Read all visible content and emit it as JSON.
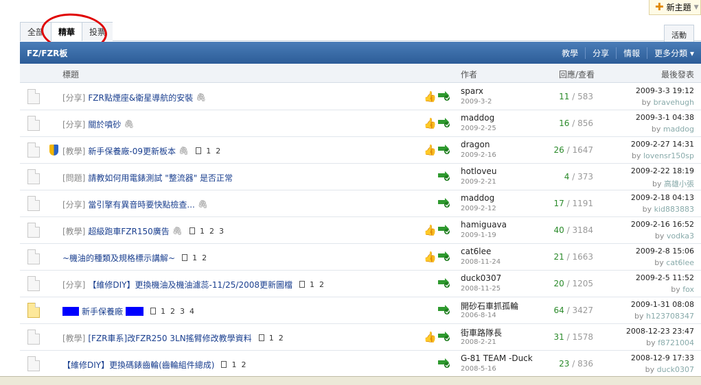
{
  "new_topic_label": "新主題",
  "tabs": [
    {
      "label": "全部",
      "active": false
    },
    {
      "label": "精華",
      "active": true
    },
    {
      "label": "投票",
      "active": false
    },
    {
      "label": "活動",
      "active": false
    }
  ],
  "forum": {
    "title": "FZ/FZR板",
    "categories": [
      "教學",
      "分享",
      "情報",
      "更多分類 ▾"
    ]
  },
  "columns": {
    "title": "標題",
    "author": "作者",
    "replies": "回應/查看",
    "last": "最後發表"
  },
  "rows": [
    {
      "tag": "[分享]",
      "title": "FZR點煙座&衛星導航的安裝",
      "clip": true,
      "pages": [],
      "thumb": true,
      "author": "sparx",
      "date": "2009-3-2",
      "replies": "11",
      "views": "583",
      "last_time": "2009-3-3 19:12",
      "last_by": "bravehugh"
    },
    {
      "tag": "[分享]",
      "title": "關於噴砂",
      "clip": true,
      "pages": [],
      "thumb": true,
      "author": "maddog",
      "date": "2009-2-25",
      "replies": "16",
      "views": "856",
      "last_time": "2009-3-1 04:38",
      "last_by": "maddog"
    },
    {
      "tag": "[教學]",
      "title": "新手保養廠-09更新板本",
      "clip": true,
      "pages": [
        "1",
        "2"
      ],
      "thumb": true,
      "shield": true,
      "author": "dragon",
      "date": "2009-2-16",
      "replies": "26",
      "views": "1647",
      "last_time": "2009-2-27 14:31",
      "last_by": "lovensr150sp"
    },
    {
      "tag": "[問題]",
      "title": "請教如何用電錶測試 \"整流器\" 是否正常",
      "clip": false,
      "pages": [],
      "thumb": false,
      "author": "hotloveu",
      "date": "2009-2-21",
      "replies": "4",
      "views": "373",
      "last_time": "2009-2-22 18:19",
      "last_by": "高雄小張"
    },
    {
      "tag": "[分享]",
      "title": "當引擎有異音時要快點檢查...",
      "clip": true,
      "pages": [],
      "thumb": false,
      "author": "maddog",
      "date": "2009-2-12",
      "replies": "17",
      "views": "1191",
      "last_time": "2009-2-18 04:13",
      "last_by": "kid883883"
    },
    {
      "tag": "[教學]",
      "title": "超級跑車FZR150廣告",
      "clip": true,
      "pages": [
        "1",
        "2",
        "3"
      ],
      "thumb": true,
      "author": "hamiguava",
      "date": "2009-1-19",
      "replies": "40",
      "views": "3184",
      "last_time": "2009-2-16 16:52",
      "last_by": "vodka3"
    },
    {
      "tag": "",
      "title": "~機油的種類及規格標示講解~",
      "clip": false,
      "pages": [
        "1",
        "2"
      ],
      "thumb": true,
      "author": "cat6lee",
      "date": "2008-11-24",
      "replies": "21",
      "views": "1663",
      "last_time": "2009-2-8 15:06",
      "last_by": "cat6lee"
    },
    {
      "tag": "[分享]",
      "title": "【維修DIY】更換機油及機油濾蕊-11/25/2008更新圖檔",
      "clip": false,
      "pages": [
        "1",
        "2"
      ],
      "thumb": false,
      "author": "duck0307",
      "date": "2008-11-25",
      "replies": "20",
      "views": "1205",
      "last_time": "2009-2-5 11:52",
      "last_by": "fox"
    },
    {
      "tag": "",
      "title": "新手保養廠",
      "clip": false,
      "pages": [
        "1",
        "2",
        "3",
        "4"
      ],
      "thumb": false,
      "highlight": true,
      "hot": true,
      "author": "開砂石車抓孤輪",
      "date": "2006-8-14",
      "replies": "64",
      "views": "3427",
      "last_time": "2009-1-31 08:08",
      "last_by": "h123708347"
    },
    {
      "tag": "[教學]",
      "title": "[FZR車系]改FZR250 3LN搖臂修改教學資料",
      "clip": false,
      "pages": [
        "1",
        "2"
      ],
      "thumb": true,
      "author": "街車路隊長",
      "date": "2008-2-21",
      "replies": "31",
      "views": "1578",
      "last_time": "2008-12-23 23:47",
      "last_by": "f8721004"
    },
    {
      "tag": "",
      "title": "【維修DIY】更換碼錶齒輪(齒輪組件總成)",
      "clip": false,
      "pages": [
        "1",
        "2"
      ],
      "thumb": false,
      "author": "G-81 TEAM -Duck",
      "date": "2008-5-16",
      "replies": "23",
      "views": "836",
      "last_time": "2008-12-9 17:33",
      "last_by": "duck0307"
    }
  ]
}
